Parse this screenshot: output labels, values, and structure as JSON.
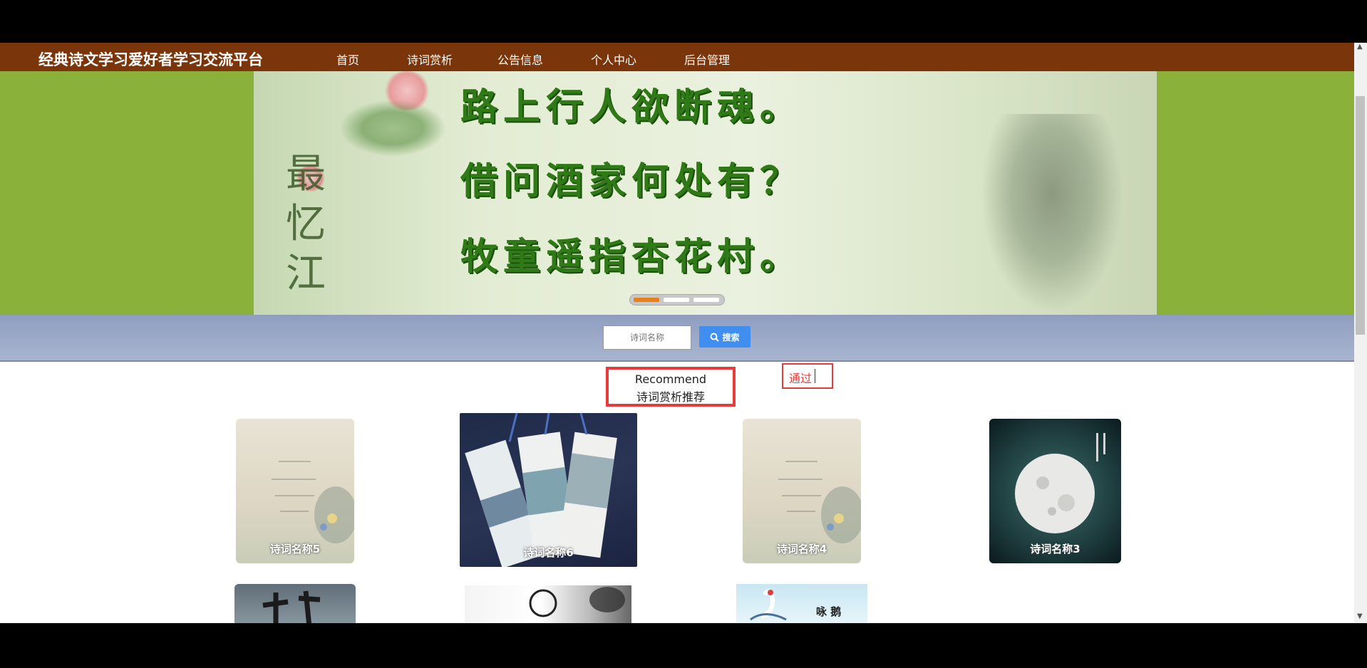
{
  "navbar": {
    "site_title": "经典诗文学习爱好者学习交流平台",
    "items": [
      {
        "label": "首页"
      },
      {
        "label": "诗词赏析"
      },
      {
        "label": "公告信息"
      },
      {
        "label": "个人中心"
      },
      {
        "label": "后台管理"
      }
    ],
    "bg_color": "#7a360a"
  },
  "banner": {
    "poem_lines": [
      "路上行人欲断魂。",
      "借问酒家何处有？",
      "牧童遥指杏花村。"
    ],
    "calligraphy": "最忆江",
    "carousel_active_index": 0,
    "carousel_count": 3
  },
  "search": {
    "placeholder": "诗词名称",
    "button_label": "搜索"
  },
  "recommend": {
    "title_en": "Recommend",
    "title_cn": "诗词赏析推荐"
  },
  "edit_overlay": {
    "text": "通过"
  },
  "cards": [
    {
      "caption": "诗词名称5",
      "theme": "beige-ink"
    },
    {
      "caption": "诗词名称6",
      "theme": "bookmarks"
    },
    {
      "caption": "诗词名称4",
      "theme": "beige-ink"
    },
    {
      "caption": "诗词名称3",
      "theme": "moon"
    }
  ],
  "cards_row2": [
    {
      "caption": "",
      "theme": "calligraphy"
    },
    {
      "caption": "",
      "theme": "ink-wash"
    },
    {
      "caption": "咏 鹅",
      "theme": "goose"
    }
  ]
}
